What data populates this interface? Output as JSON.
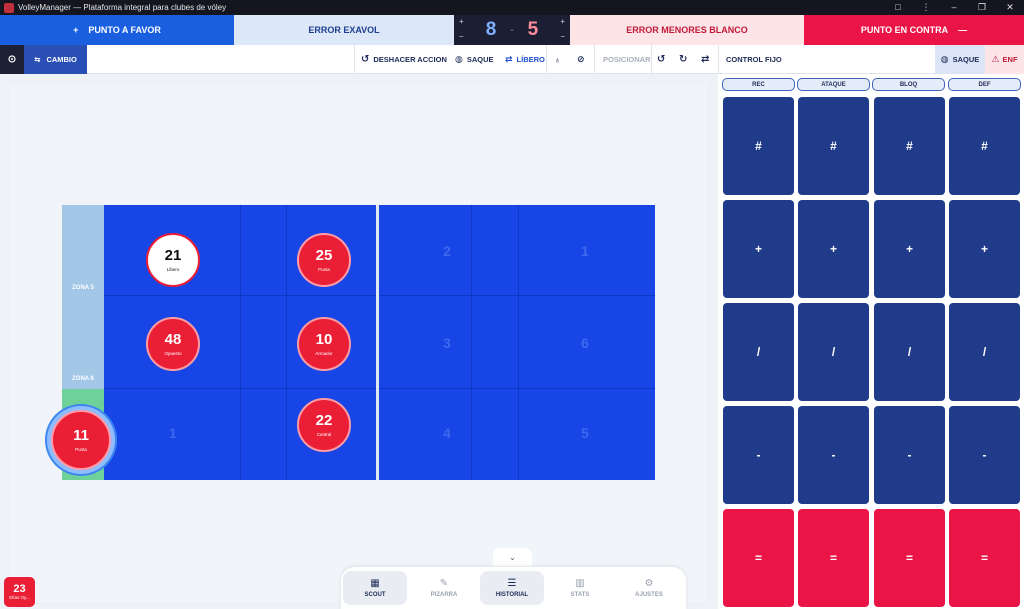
{
  "window": {
    "title": "VolleyManager — Plataforma integral para clubes de vóley",
    "controls": [
      "□",
      "⋮",
      "–",
      "❐",
      "✕"
    ]
  },
  "scorebar": {
    "punto_favor": "PUNTO A FAVOR",
    "error_exavol": "ERROR EXAVOL",
    "score_home": "8",
    "score_sep": "-",
    "score_away": "5",
    "plus": "+",
    "minus": "−",
    "error_menores": "ERROR MENORES BLANCO",
    "punto_contra": "PUNTO EN CONTRA",
    "contra_minus": "—",
    "favor_plus": "+"
  },
  "toolbar": {
    "cambio": "CAMBIO",
    "deshacer": "DESHACER ACCION",
    "saque": "SAQUE",
    "libero": "LÍBERO",
    "posicionar": "POSICIONAR",
    "control_fijo": "CONTROL FIJO",
    "saque_right": "SAQUE",
    "enf": "ENF"
  },
  "court": {
    "zones": [
      "ZONA 5",
      "ZONA 6",
      "ZONA 1"
    ],
    "cells": {
      "c1": "1",
      "r1": "2",
      "r2": "1",
      "r3": "3",
      "r4": "6",
      "r5": "4",
      "r6": "5"
    },
    "players": [
      {
        "number": "21",
        "role": "Líbero"
      },
      {
        "number": "25",
        "role": "Punta"
      },
      {
        "number": "48",
        "role": "Opuesto"
      },
      {
        "number": "10",
        "role": "Armador"
      },
      {
        "number": "11",
        "role": "Punta"
      },
      {
        "number": "22",
        "role": "Central"
      }
    ]
  },
  "stats": {
    "headers": [
      "REC",
      "ATAQUE",
      "BLOQ",
      "DEF"
    ],
    "rows": [
      "#",
      "+",
      "/",
      "-",
      "="
    ]
  },
  "nav": {
    "tabs": [
      "SCOUT",
      "PIZARRA",
      "HISTORIAL",
      "STATS",
      "AJUSTES"
    ],
    "collapse": "⌄"
  },
  "badge": {
    "number": "23",
    "label": "Elías Oy..."
  },
  "colors": {
    "favor": "#1a5fe0",
    "contra": "#ea1447",
    "court": "#1846e6",
    "stat_button": "#1f3b8a",
    "player": "#ea1f35"
  }
}
